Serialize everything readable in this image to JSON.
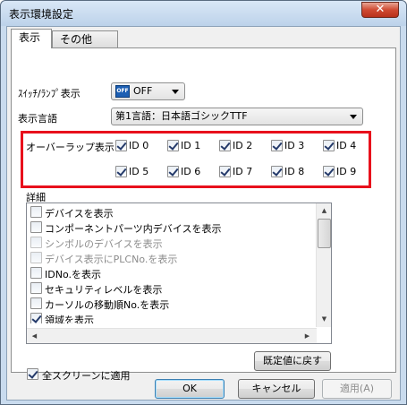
{
  "window": {
    "title": "表示環境設定",
    "close_glyph": "✕"
  },
  "tabs": [
    {
      "label": "表示"
    },
    {
      "label": "その他"
    }
  ],
  "switch_lamp": {
    "label": "ｽｲｯﾁ/ﾗﾝﾌﾟ表示",
    "value": "OFF",
    "icon_text": "OFF"
  },
  "display_language": {
    "label": "表示言語",
    "value": "第1言語：日本語ゴシックTTF"
  },
  "overlap": {
    "label": "オーバーラップ表示",
    "items": [
      {
        "label": "ID 0",
        "checked": true
      },
      {
        "label": "ID 1",
        "checked": true
      },
      {
        "label": "ID 2",
        "checked": true
      },
      {
        "label": "ID 3",
        "checked": true
      },
      {
        "label": "ID 4",
        "checked": true
      },
      {
        "label": "ID 5",
        "checked": true
      },
      {
        "label": "ID 6",
        "checked": true
      },
      {
        "label": "ID 7",
        "checked": true
      },
      {
        "label": "ID 8",
        "checked": true
      },
      {
        "label": "ID 9",
        "checked": true
      }
    ]
  },
  "details": {
    "label": "詳細",
    "items": [
      {
        "label": "デバイスを表示",
        "checked": false,
        "enabled": true
      },
      {
        "label": "コンポーネントパーツ内デバイスを表示",
        "checked": false,
        "enabled": true
      },
      {
        "label": "シンボルのデバイスを表示",
        "checked": false,
        "enabled": false
      },
      {
        "label": "デバイス表示にPLCNo.を表示",
        "checked": false,
        "enabled": false
      },
      {
        "label": "IDNo.を表示",
        "checked": false,
        "enabled": true
      },
      {
        "label": "セキュリティレベルを表示",
        "checked": false,
        "enabled": true
      },
      {
        "label": "カーソルの移動順No.を表示",
        "checked": false,
        "enabled": true
      },
      {
        "label": "領域を表示",
        "checked": true,
        "enabled": true
      }
    ]
  },
  "reset_button": "既定値に戻す",
  "apply_all": {
    "label": "全スクリーンに適用",
    "checked": true
  },
  "buttons": {
    "ok": "OK",
    "cancel": "キャンセル",
    "apply": "適用(A)"
  }
}
